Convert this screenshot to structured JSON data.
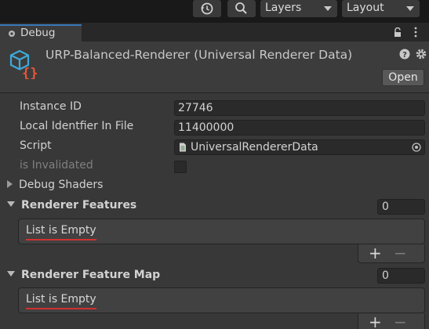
{
  "toolbar": {
    "layers_label": "Layers",
    "layout_label": "Layout"
  },
  "tab": {
    "label": "Debug"
  },
  "inspector": {
    "title": "URP-Balanced-Renderer (Universal Renderer Data)",
    "open_label": "Open"
  },
  "fields": {
    "instance_id_label": "Instance ID",
    "instance_id_value": "27746",
    "local_id_label": "Local Identfier In File",
    "local_id_value": "11400000",
    "script_label": "Script",
    "script_value": "UniversalRendererData",
    "invalidated_label": "is Invalidated",
    "invalidated_checked": false
  },
  "sections": {
    "debug_shaders_label": "Debug Shaders",
    "renderer_features_label": "Renderer Features",
    "renderer_features_count": "0",
    "renderer_features_empty": "List is Empty",
    "feature_map_label": "Renderer Feature Map",
    "feature_map_count": "0",
    "feature_map_empty": "List is Empty"
  },
  "list_controls": {
    "add_symbol": "+",
    "remove_symbol": "−"
  },
  "colors": {
    "accent_tab": "#3a79bb",
    "asset_icon": "#3fa9d8",
    "asset_braces": "#e8563a",
    "spellcheck_underline": "#d03030"
  }
}
